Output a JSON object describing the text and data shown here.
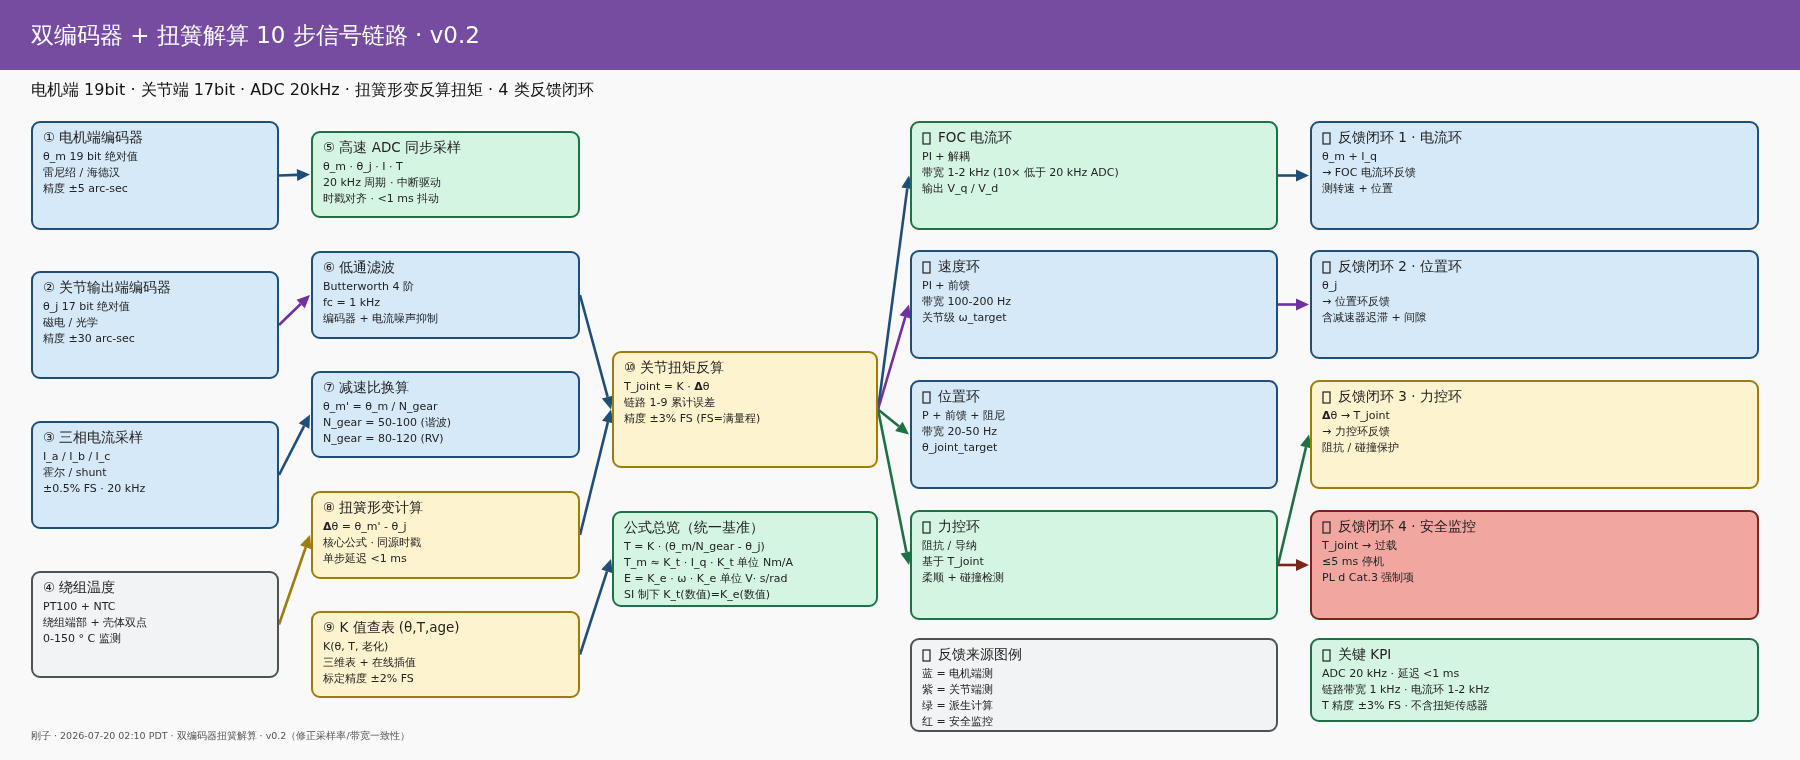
{
  "header": {
    "title": "双编码器 + 扭簧解算 10 步信号链路 ·  v0.2"
  },
  "subtitle": "电机端 19bit ·  关节端 17bit ·  ADC 20kHz ·  扭簧形变反算扭矩 ·  4 类反馈闭环",
  "nodes": [
    {
      "title": "① 电机端编码器",
      "icon": false,
      "color": "#1f4e79",
      "lines": [
        "θ_m  19 bit 绝对值",
        "雷尼绍 / 海德汉",
        "精度 ±5 arc-sec"
      ]
    },
    {
      "title": "② 关节输出端编码器",
      "icon": false,
      "color": "#1f4e79",
      "lines": [
        "θ_j  17 bit 绝对值",
        "磁电 / 光学",
        "精度 ±30 arc-sec"
      ]
    },
    {
      "title": "③ 三相电流采样",
      "icon": false,
      "color": "#1f4e79",
      "lines": [
        "I_a / I_b / I_c",
        "霍尔 / shunt",
        "±0.5% FS ·  20 kHz"
      ]
    },
    {
      "title": "④ 绕组温度",
      "icon": false,
      "color": "#4a5458",
      "lines": [
        "PT100 + NTC",
        "绕组端部 + 壳体双点",
        "0-150 °  C 监测"
      ]
    },
    {
      "title": "⑤ 高速 ADC 同步采样",
      "icon": false,
      "color": "#1e7145",
      "lines": [
        "θ_m ·  θ_j ·  I ·  T",
        "20 kHz 周期 ·  中断驱动",
        "时戳对齐 ·  <1 ms 抖动"
      ]
    },
    {
      "title": "⑥ 低通滤波",
      "icon": false,
      "color": "#1f4e79",
      "lines": [
        "Butterworth 4 阶",
        "fc = 1 kHz",
        "编码器 + 电流噪声抑制"
      ]
    },
    {
      "title": "⑦ 减速比换算",
      "icon": false,
      "color": "#1f4e79",
      "lines": [
        "θ_m' = θ_m / N_gear",
        "N_gear = 50-100 (谐波)",
        "N_gear = 80-120 (RV)"
      ]
    },
    {
      "title": "⑧ 扭簧形变计算",
      "icon": false,
      "color": "#9c7c0c",
      "lines": [
        "**Δ**θ = θ_m' - θ_j",
        "核心公式 ·  同源时戳",
        "单步延迟 <1 ms"
      ]
    },
    {
      "title": "⑨ K 值查表 (θ,T,age)",
      "icon": false,
      "color": "#9c7c0c",
      "lines": [
        "K(θ, T, 老化)",
        "三维表 + 在线插值",
        "标定精度 ±2% FS"
      ]
    },
    {
      "title": "⑩ 关节扭矩反算",
      "icon": false,
      "color": "#9c7c0c",
      "lines": [
        "T_joint = K ·  **Δ**θ",
        "链路 1-9 累计误差",
        "精度 ±3% FS (FS=满量程)"
      ]
    },
    {
      "title": "公式总览（统一基准）",
      "icon": false,
      "color": "#1e7145",
      "lines": [
        "T = K ·  (θ_m/N_gear - θ_j)",
        "T_m ≈ K_t ·  I_q ·  K_t 单位 Nm/A",
        "E = K_e ·  ω ·  K_e 单位 V· s/rad",
        "SI 制下 K_t(数值)=K_e(数值)"
      ]
    },
    {
      "title": "FOC 电流环",
      "icon": true,
      "color": "#1e7145",
      "lines": [
        "PI + 解耦",
        "带宽 1-2 kHz (10× 低于 20 kHz ADC)",
        "输出 V_q / V_d"
      ]
    },
    {
      "title": "速度环",
      "icon": true,
      "color": "#1f4e79",
      "lines": [
        "PI + 前馈",
        "带宽 100-200 Hz",
        "关节级 ω_target"
      ]
    },
    {
      "title": "位置环",
      "icon": true,
      "color": "#1f4e79",
      "lines": [
        "P + 前馈 + 阻尼",
        "带宽 20-50 Hz",
        "θ_joint_target"
      ]
    },
    {
      "title": "力控环",
      "icon": true,
      "color": "#1e7145",
      "lines": [
        "阻抗 / 导纳",
        "基于 T_joint",
        "柔顺 + 碰撞检测"
      ]
    },
    {
      "title": "反馈来源图例",
      "icon": true,
      "color": "#4a5458",
      "lines": [
        "蓝 = 电机端测",
        "紫 = 关节端测",
        "绿 = 派生计算",
        "红 = 安全监控"
      ]
    },
    {
      "title": "反馈闭环 1 ·  电流环",
      "icon": true,
      "color": "#1f4e79",
      "lines": [
        "θ_m + I_q",
        "→ FOC 电流环反馈",
        "测转速 + 位置"
      ]
    },
    {
      "title": "反馈闭环 2 ·  位置环",
      "icon": true,
      "color": "#1f4e79",
      "lines": [
        "θ_j",
        "→ 位置环反馈",
        "含减速器迟滞 + 间隙"
      ]
    },
    {
      "title": "反馈闭环 3 ·  力控环",
      "icon": true,
      "color": "#9c7c0c",
      "lines": [
        "**Δ**θ → T_joint",
        "→ 力控环反馈",
        "阻抗 / 碰撞保护"
      ]
    },
    {
      "title": "反馈闭环 4 ·  安全监控",
      "icon": true,
      "color": "#7b241c",
      "lines": [
        "T_joint → 过载",
        "≤5 ms 停机",
        "PL d Cat.3 强制项"
      ]
    },
    {
      "title": "关键 KPI",
      "icon": true,
      "color": "#1e7145",
      "lines": [
        "ADC 20 kHz ·  延迟 <1 ms",
        "链路带宽 1 kHz ·  电流环 1-2 kHz",
        "T 精度 ±3% FS ·  不含扭矩传感器"
      ]
    }
  ],
  "edges": [
    {
      "color": "#1f4e79"
    },
    {
      "color": "#7030a0"
    },
    {
      "color": "#1f4e79"
    },
    {
      "color": "#9c7c0c"
    },
    {
      "color": "#1f4e79"
    },
    {
      "color": "#1f4e79"
    },
    {
      "color": "#1f4e79"
    },
    {
      "color": "#1f4e79"
    },
    {
      "color": "#7030a0"
    },
    {
      "color": "#1e7145"
    },
    {
      "color": "#1e7145"
    },
    {
      "color": "#1f4e79"
    },
    {
      "color": "#7030a0"
    },
    {
      "color": "#1e7145"
    },
    {
      "color": "#7b241c"
    }
  ],
  "footer": "刚子 ·  2026-07-20 02:10 PDT ·  双编码器扭簧解算 ·  v0.2（修正采样率/带宽一致性）"
}
